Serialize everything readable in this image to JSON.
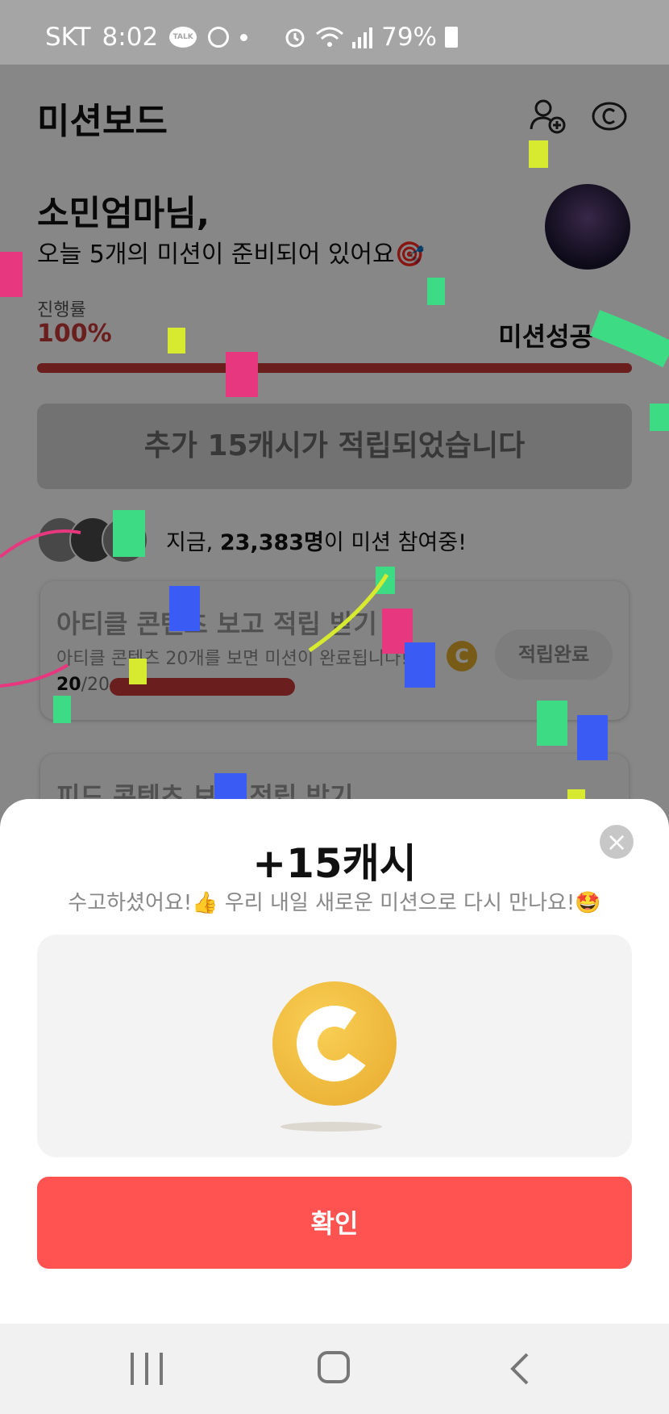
{
  "status_bar": {
    "carrier": "SKT",
    "time": "8:02",
    "talk_badge": "TALK",
    "battery_percent": "79%"
  },
  "header": {
    "title": "미션보드"
  },
  "greeting": {
    "name": "소민엄마님,",
    "subtitle": "오늘 5개의 미션이 준비되어 있어요🎯"
  },
  "progress": {
    "label": "진행률",
    "value": "100%",
    "fraction": 1.0,
    "status": "미션성공"
  },
  "reward_banner": "추가 15캐시가 적립되었습니다",
  "participants": {
    "prefix": "지금, ",
    "count": "23,383명",
    "suffix": "이 미션 참여중!"
  },
  "missions": [
    {
      "title": "아티클 콘텐츠 보고 적립 받기",
      "description": "아티클 콘텐츠 20개를 보면 미션이 완료됩니다!",
      "done": "20",
      "total": "/20",
      "button": "적립완료",
      "coin": "C"
    },
    {
      "title": "피드 콘텐츠 보고 적립 받기"
    }
  ],
  "sheet": {
    "title": "+15캐시",
    "subtitle": "수고하셨어요!👍 우리 내일 새로운 미션으로 다시 만나요!🤩",
    "confirm": "확인",
    "close_glyph": "×"
  },
  "colors": {
    "accent_red": "#fe5350",
    "progress_red": "#c83a3a",
    "coin_gold": "#f4bf3f"
  },
  "icons": [
    "add-friend-icon",
    "coin-outline-icon",
    "close-icon",
    "coin-icon",
    "nav-recents-icon",
    "nav-home-icon",
    "nav-back-icon"
  ]
}
